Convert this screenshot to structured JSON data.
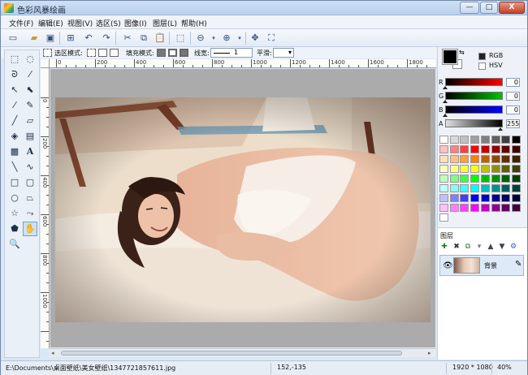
{
  "window": {
    "title": "色彩风暴绘画",
    "min_label": "—",
    "max_label": "□",
    "close_label": "X"
  },
  "menu": [
    "文件(F)",
    "编辑(E)",
    "视图(V)",
    "选区(S)",
    "图像(I)",
    "图层(L)",
    "帮助(H)"
  ],
  "toolbar_icons": [
    "new-file",
    "open-folder",
    "save",
    "import",
    "undo",
    "redo",
    "cut",
    "copy",
    "paste",
    "deselect",
    "zoom-out",
    "zoom-in",
    "fit-window",
    "actual-size"
  ],
  "options": {
    "selection_mode_label": "选区模式:",
    "fill_mode_label": "填充模式:",
    "line_width_label": "线宽:",
    "line_width_value": "1",
    "smooth_label": "平滑:",
    "smooth_value": "▾"
  },
  "ruler": {
    "top": [
      "0",
      "200",
      "400",
      "600",
      "800",
      "1000",
      "1200",
      "1400",
      "1600",
      "1800"
    ],
    "left": [
      "0",
      "200",
      "400",
      "600",
      "800",
      "1000"
    ]
  },
  "color": {
    "mode_rgb": "RGB",
    "mode_hsv": "HSV",
    "selected_mode": "RGB",
    "channels": [
      {
        "label": "R",
        "value": "0",
        "gradient": [
          "#000000",
          "#ff0000"
        ]
      },
      {
        "label": "G",
        "value": "0",
        "gradient": [
          "#000000",
          "#00c000"
        ]
      },
      {
        "label": "B",
        "value": "0",
        "gradient": [
          "#000000",
          "#0000ff"
        ]
      },
      {
        "label": "A",
        "value": "255",
        "gradient": [
          "#e0e0e0",
          "#000000"
        ]
      }
    ],
    "foreground": "#000000",
    "background": "#ffffff"
  },
  "palette_rows": [
    [
      "#ffffff",
      "#d9d9d9",
      "#c0c0c0",
      "#a0a0a0",
      "#808080",
      "#606060",
      "#404040",
      "#000000"
    ],
    [
      "#ffc0c0",
      "#ff8080",
      "#ff4040",
      "#ff0000",
      "#c00000",
      "#900000",
      "#600000",
      "#400000"
    ],
    [
      "#ffe0c0",
      "#ffc080",
      "#ffa040",
      "#ff8000",
      "#c06000",
      "#904800",
      "#603000",
      "#402000"
    ],
    [
      "#ffffc0",
      "#ffff80",
      "#ffff40",
      "#ffff00",
      "#c0c000",
      "#909000",
      "#606000",
      "#404000"
    ],
    [
      "#c0ffc0",
      "#80ff80",
      "#40ff40",
      "#00ff00",
      "#00c000",
      "#009000",
      "#006000",
      "#004000"
    ],
    [
      "#c0ffff",
      "#80ffff",
      "#40ffff",
      "#00ffff",
      "#00c0c0",
      "#009090",
      "#006060",
      "#004040"
    ],
    [
      "#c0c0ff",
      "#8080ff",
      "#4040ff",
      "#0000ff",
      "#0000c0",
      "#000090",
      "#000060",
      "#000040"
    ],
    [
      "#ffc0ff",
      "#ff80ff",
      "#ff40ff",
      "#ff00ff",
      "#c000c0",
      "#900090",
      "#600060",
      "#400040"
    ],
    [
      "#ffffff"
    ]
  ],
  "layers": {
    "title": "图层",
    "items": [
      {
        "name": "背景"
      }
    ]
  },
  "status": {
    "path": "E:\\Documents\\桌面壁纸\\美女壁纸\\1347721857611.jpg",
    "coords": "152,-135",
    "dimensions": "1920 * 1080",
    "zoom": "40%"
  }
}
